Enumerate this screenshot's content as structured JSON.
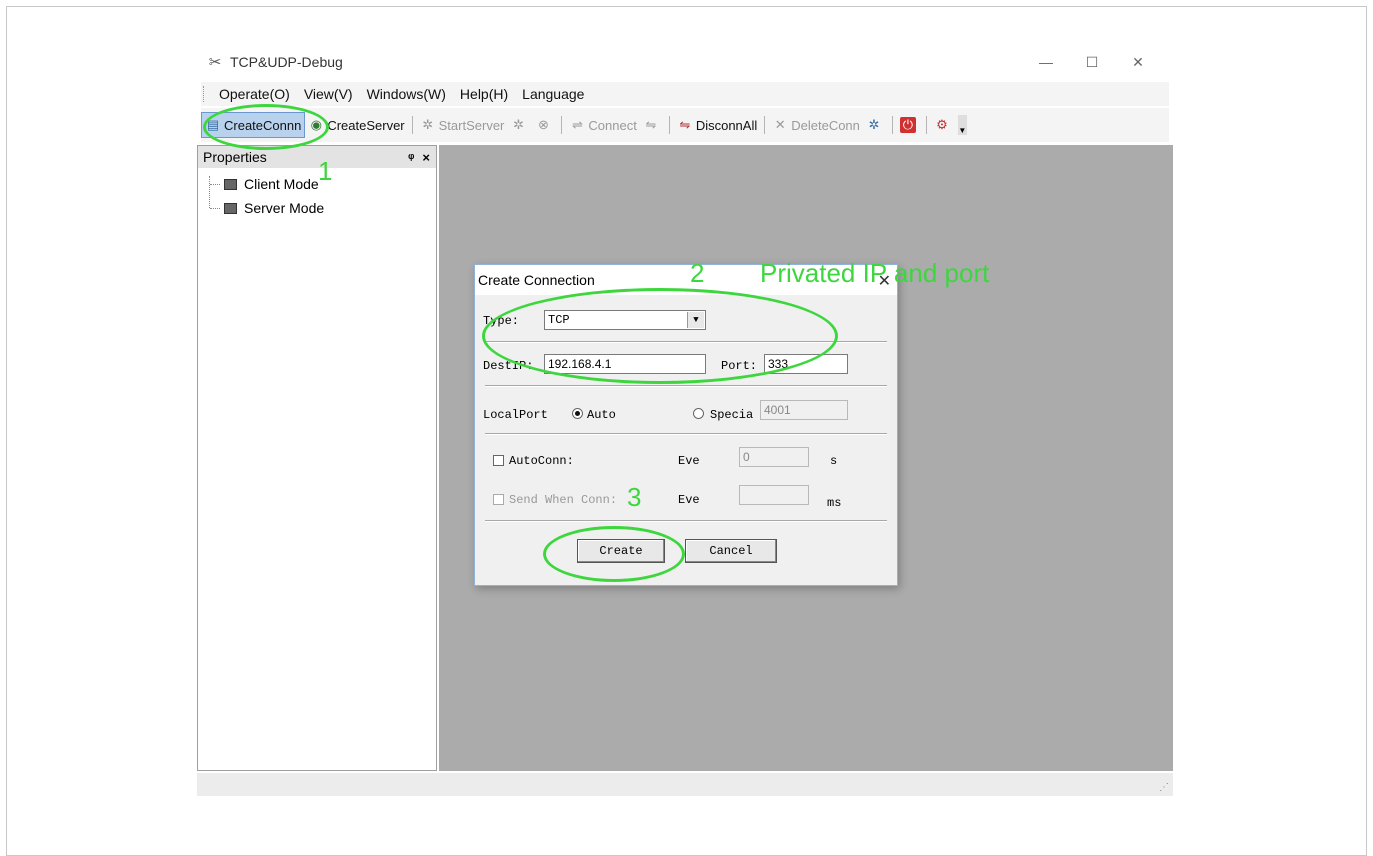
{
  "window": {
    "title": "TCP&UDP-Debug",
    "controls": {
      "minimize": "—",
      "maximize": "☐",
      "close": "✕"
    }
  },
  "menu": {
    "items": [
      "Operate(O)",
      "View(V)",
      "Windows(W)",
      "Help(H)",
      "Language"
    ]
  },
  "toolbar": {
    "create_conn": "CreateConnn",
    "create_server": "CreateServer",
    "start_server": "StartServer",
    "connect": "Connect",
    "disconn_all": "DisconnAll",
    "delete_conn": "DeleteConn"
  },
  "properties": {
    "title": "Properties",
    "pin": "ᵠ",
    "close": "×",
    "items": [
      "Client Mode",
      "Server Mode"
    ]
  },
  "dialog": {
    "title": "Create Connection",
    "type_label": "Type:",
    "type_value": "TCP",
    "destip_label": "DestIP:",
    "destip_value": "192.168.4.1",
    "port_label": "Port:",
    "port_value": "333",
    "localport_label": "LocalPort",
    "auto_label": "Auto",
    "special_label": "Specia",
    "special_value": "4001",
    "autoconn_label": "AutoConn:",
    "eve_label_1": "Eve",
    "eve_value_1": "0",
    "unit_s": "s",
    "sendwhen_label": "Send When Conn:",
    "eve_label_2": "Eve",
    "eve_value_2": "",
    "unit_ms": "ms",
    "create_button": "Create",
    "cancel_button": "Cancel"
  },
  "annotations": {
    "step1": "1",
    "step2": "2",
    "step2_text": "Privated IP and  port",
    "step3": "3",
    "color": "#3ed63e"
  }
}
